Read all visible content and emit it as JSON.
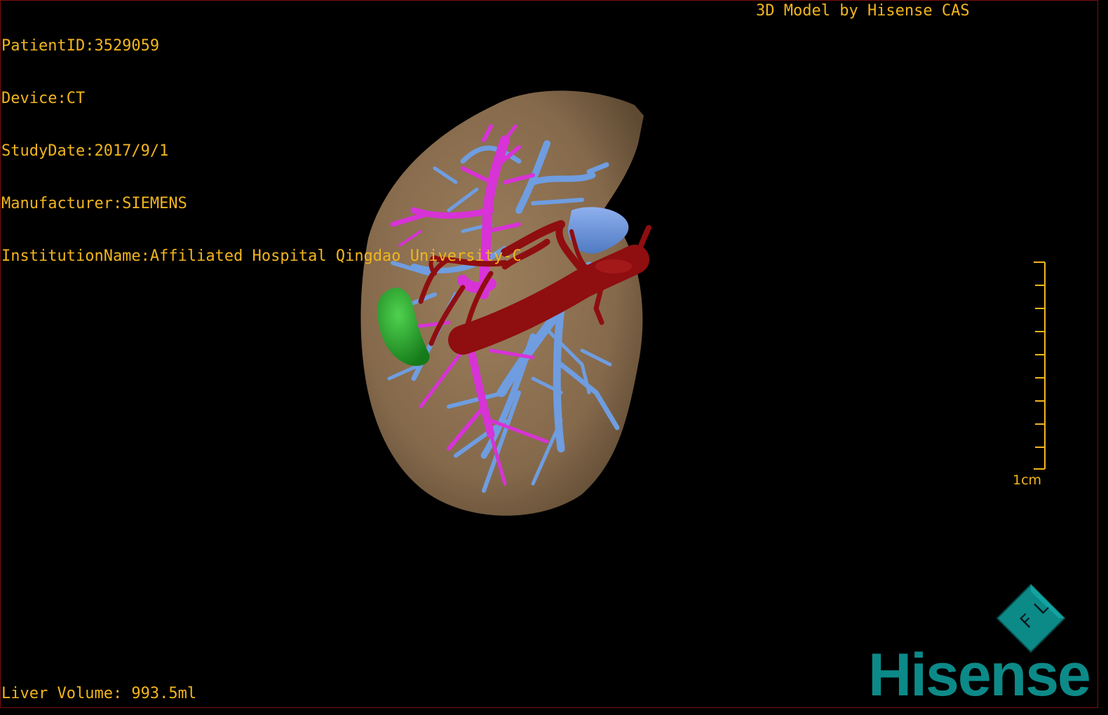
{
  "overlay": {
    "patient_id": "PatientID:3529059",
    "device": "Device:CT",
    "study_date": "StudyDate:2017/9/1",
    "manufacturer": "Manufacturer:SIEMENS",
    "institution": "InstitutionName:Affiliated Hospital Qingdao University-C",
    "title": "3D Model by Hisense CAS",
    "liver_volume": "Liver Volume: 993.5ml"
  },
  "scale": {
    "label": "1cm"
  },
  "orientation": {
    "letters": [
      "F",
      "L"
    ]
  },
  "brand": {
    "name": "Hisense"
  },
  "colors": {
    "text": "#f2b51e",
    "liver": "#8c7252",
    "portal_vein": "#6f9de0",
    "hepatic_vein": "#d733d6",
    "artery": "#8f0e10",
    "gallbladder": "#25a22a",
    "brand": "#0c8a88"
  }
}
